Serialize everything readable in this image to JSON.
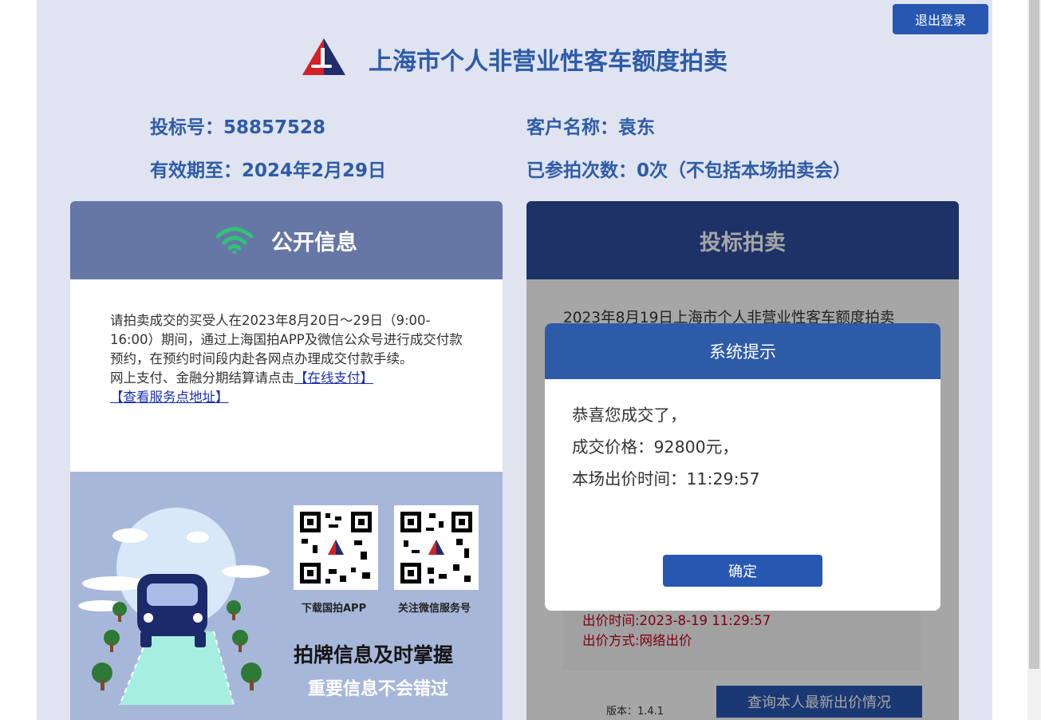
{
  "header": {
    "logout_label": "退出登录",
    "title": "上海市个人非营业性客车额度拍卖"
  },
  "user_info": {
    "bid_number": "投标号：58857528",
    "customer_name": "客户名称：袁东",
    "valid_until": "有效期至：2024年2月29日",
    "participation_count": "已参拍次数：0次（不包括本场拍卖会）"
  },
  "public_info": {
    "title": "公开信息",
    "notice": "请拍卖成交的买受人在2023年8月20日～29日（9:00-16:00）期间，通过上海国拍APP及微信公众号进行成交付款预约，在预约时间段内赴各网点办理成交付款手续。",
    "payment_text": "网上支付、金融分期结算请点击",
    "online_pay_link": "【在线支付】",
    "service_address_link": "【查看服务点地址】",
    "qr_app_label": "下载国拍APP",
    "qr_wechat_label": "关注微信服务号",
    "promo_headline": "拍牌信息及时掌握",
    "promo_subline": "重要信息不会错过"
  },
  "bidding": {
    "title": "投标拍卖",
    "auction_title": "2023年8月19日上海市个人非营业性客车额度拍卖",
    "bid_time": "出价时间:2023-8-19 11:29:57",
    "bid_method": "出价方式:网络出价",
    "version": "版本：1.4.1",
    "query_button": "查询本人最新出价情况"
  },
  "dialog": {
    "title": "系统提示",
    "line1": "恭喜您成交了，",
    "line2": "成交价格：92800元，",
    "line3": "本场出价时间：11:29:57",
    "ok_label": "确定"
  },
  "colors": {
    "brand_blue": "#2857b2",
    "title_blue": "#2e5ba8",
    "bid_red": "#c0001a",
    "wifi_green": "#2fc27a"
  }
}
